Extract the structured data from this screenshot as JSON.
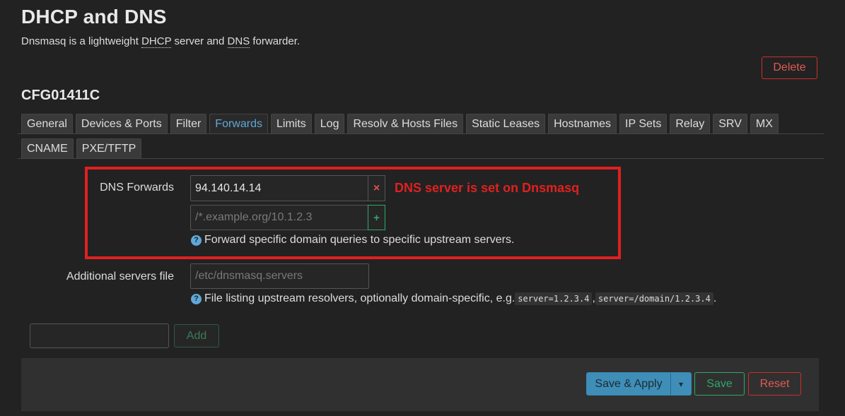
{
  "page": {
    "title": "DHCP and DNS",
    "desc_part1": "Dnsmasq is a lightweight ",
    "desc_abbr1": "DHCP",
    "desc_part2": " server and ",
    "desc_abbr2": "DNS",
    "desc_part3": " forwarder."
  },
  "section": {
    "delete_label": "Delete",
    "name": "CFG01411C"
  },
  "tabs_row1": [
    "General",
    "Devices & Ports",
    "Filter",
    "Forwards",
    "Limits",
    "Log",
    "Resolv & Hosts Files",
    "Static Leases",
    "Hostnames",
    "IP Sets",
    "Relay",
    "SRV",
    "MX"
  ],
  "tabs_row2": [
    "CNAME",
    "PXE/TFTP"
  ],
  "active_tab": "Forwards",
  "dns_forwards": {
    "label": "DNS Forwards",
    "value": "94.140.14.14",
    "remove_glyph": "×",
    "new_placeholder": "/*.example.org/10.1.2.3",
    "add_glyph": "+",
    "help": "Forward specific domain queries to specific upstream servers."
  },
  "additional_servers": {
    "label": "Additional servers file",
    "placeholder": "/etc/dnsmasq.servers",
    "help_prefix": "File listing upstream resolvers, optionally domain-specific, e.g. ",
    "code1": "server=1.2.3.4",
    "sep": ", ",
    "code2": "server=/domain/1.2.3.4",
    "help_suffix": "."
  },
  "annotation": {
    "text": "DNS server is set on Dnsmasq",
    "color": "#e02020"
  },
  "add_section": {
    "input_value": "",
    "add_label": "Add"
  },
  "footer": {
    "save_apply_label": "Save & Apply",
    "dropdown_glyph": "▾",
    "save_label": "Save",
    "reset_label": "Reset"
  },
  "colors": {
    "background": "#222222",
    "accent_blue": "#5fa8d8",
    "positive_green": "#2ea86b",
    "negative_red": "#c9302c"
  }
}
